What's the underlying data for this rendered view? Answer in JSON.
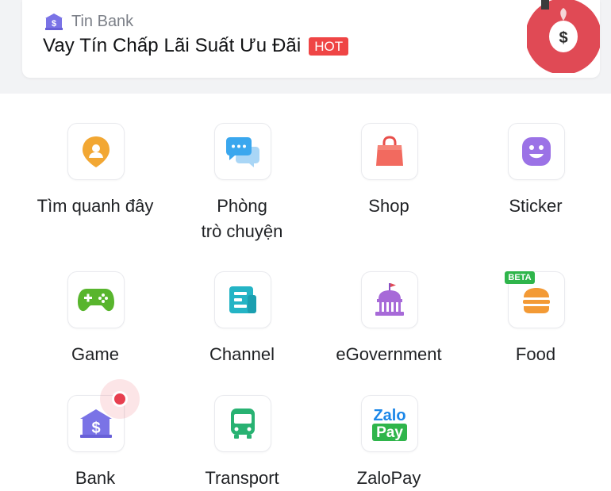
{
  "promo": {
    "source": "Tin Bank",
    "title": "Vay Tín Chấp Lãi Suất Ưu Đãi",
    "badge": "HOT",
    "icons": {
      "source": "bank-icon",
      "image": "money-bag-icon"
    }
  },
  "apps": [
    {
      "label": "Tìm quanh đây",
      "icon": "location-pin-icon"
    },
    {
      "label": "Phòng",
      "label2": "trò chuyện",
      "icon": "chat-bubbles-icon"
    },
    {
      "label": "Shop",
      "icon": "shopping-bag-icon"
    },
    {
      "label": "Sticker",
      "icon": "smiley-sticker-icon"
    },
    {
      "label": "Game",
      "icon": "gamepad-icon"
    },
    {
      "label": "Channel",
      "icon": "channel-doc-icon"
    },
    {
      "label": "eGovernment",
      "icon": "government-building-icon"
    },
    {
      "label": "Food",
      "icon": "burger-icon",
      "tag": "BETA"
    },
    {
      "label": "Bank",
      "icon": "bank-icon",
      "notification": true
    },
    {
      "label": "Transport",
      "icon": "bus-icon"
    },
    {
      "label": "ZaloPay",
      "icon": "zalopay-logo",
      "logo_text": [
        "Zalo",
        "Pay"
      ]
    }
  ],
  "colors": {
    "hot": "#ef4545",
    "location": "#f2a733",
    "chat": "#3aa7ee",
    "shop": "#f26a5f",
    "sticker": "#9b72e6",
    "game": "#58b52d",
    "channel": "#24b4c5",
    "egov": "#a76ad8",
    "food": "#f39a35",
    "bank": "#7a73e6",
    "transport": "#28b272",
    "zalo": "#1a86e8",
    "pay": "#2fb54b"
  }
}
